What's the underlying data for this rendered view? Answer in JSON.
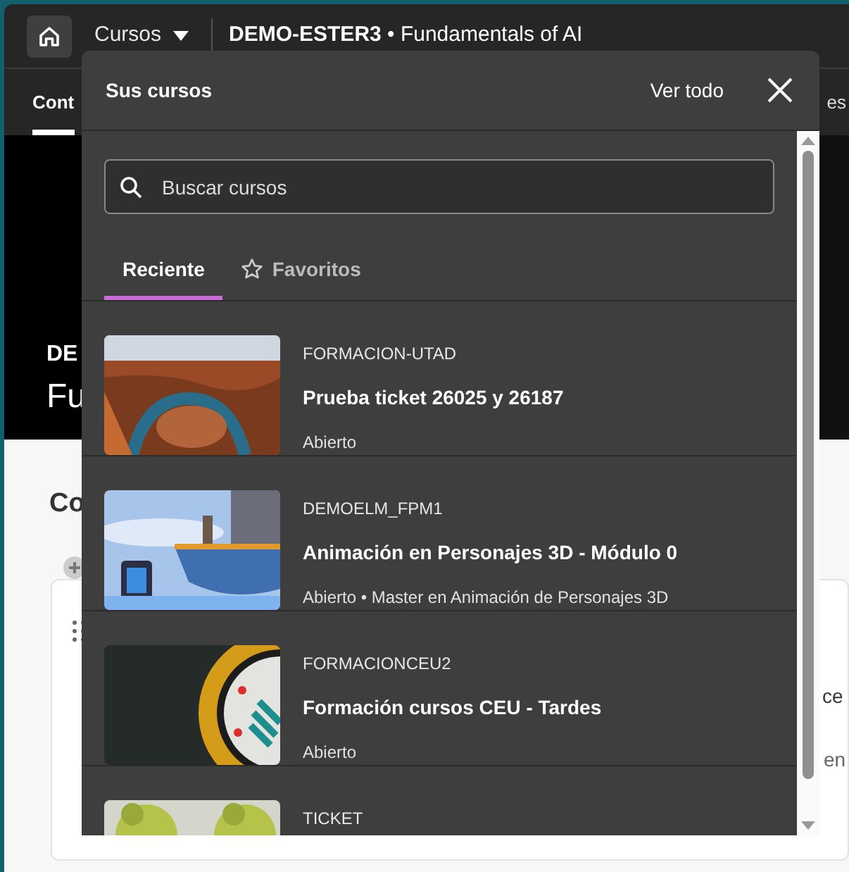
{
  "top_bar": {
    "menu_label": "Cursos",
    "course_title": "**DEMO-ESTER3** • Fundamentals of AI"
  },
  "background_page": {
    "tab_label": "Cont",
    "tab_label_right": "es",
    "hero_line_1": "DE",
    "hero_line_2": "Fu",
    "section_heading": "Co",
    "card_text_1": "ce",
    "card_text_2": "en"
  },
  "courses_panel": {
    "title": "Sus cursos",
    "view_all": "Ver todo",
    "search": {
      "placeholder": "Buscar cursos"
    },
    "tabs": [
      {
        "label": "Reciente",
        "kind": "plain",
        "selected": true
      },
      {
        "label": "Favoritos",
        "kind": "starred",
        "selected": false
      }
    ],
    "courses": [
      {
        "code": "FORMACION-UTAD",
        "title": "Prueba ticket 26025 y 26187",
        "meta": "Abierto",
        "kind": "picture"
      },
      {
        "code": "DEMOELM_FPM1",
        "title": "Animación en Personajes 3D - Módulo 0",
        "meta": "Abierto • Master en Animación de Personajes 3D",
        "kind": "picture"
      },
      {
        "code": "FORMACIONCEU2",
        "title": "Formación cursos CEU - Tardes",
        "meta": "Abierto",
        "kind": "picture"
      },
      {
        "code": "TICKET",
        "kind": "picture"
      }
    ]
  }
}
